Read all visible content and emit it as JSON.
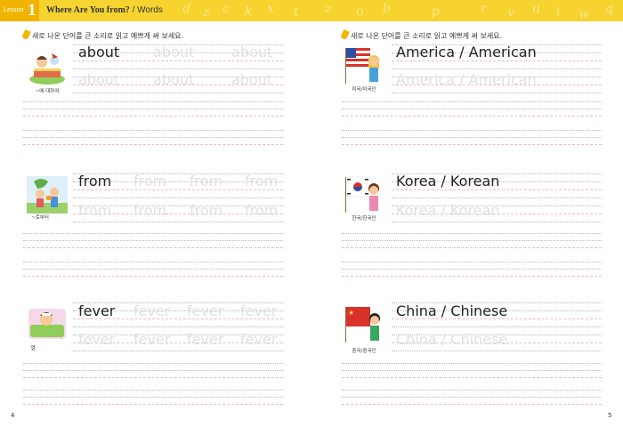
{
  "header": {
    "lesson_word": "Lesson",
    "lesson_number": "1",
    "title": "Where Are You from?",
    "subtitle": " / Words",
    "deco_letters": [
      "d",
      "z",
      "c",
      "k",
      "x",
      "t",
      "z",
      "o",
      "b",
      "p",
      "r",
      "v",
      "u",
      "i",
      "w",
      "q"
    ]
  },
  "instruction_left": "새로 나온 단어를 큰 소리로 읽고 예쁘게 써 보세요.",
  "instruction_right": "새로 나온 단어를 큰 소리로 읽고 예쁘게 써 보세요.",
  "left_words": [
    {
      "word": "about",
      "caption": "~에 대하여"
    },
    {
      "word": "from",
      "caption": "~로부터"
    },
    {
      "word": "fever",
      "caption": "열"
    }
  ],
  "right_words": [
    {
      "word": "America / American",
      "caption": "미국/미국인"
    },
    {
      "word": "Korea / Korean",
      "caption": "한국/한국인"
    },
    {
      "word": "China / Chinese",
      "caption": "중국/중국인"
    }
  ],
  "page_left": "4",
  "page_right": "5",
  "colors": {
    "header": "#f7d330",
    "tab": "#f0b400",
    "ghost": "#e0e0e0"
  }
}
